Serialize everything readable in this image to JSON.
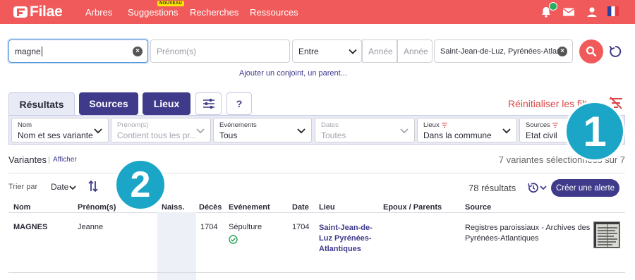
{
  "header": {
    "logo_text": "Filae",
    "nav": [
      {
        "label": "Arbres"
      },
      {
        "label": "Suggestions",
        "badge": "NOUVEAU"
      },
      {
        "label": "Recherches"
      },
      {
        "label": "Ressources"
      }
    ],
    "icons": [
      "bell-icon",
      "mail-icon",
      "user-icon",
      "flag-fr-icon"
    ]
  },
  "search": {
    "name_value": "magne",
    "firstname_placeholder": "Prénom(s)",
    "range_value": "Entre",
    "year_from_placeholder": "Année",
    "year_to_placeholder": "Année",
    "place_value": "Saint-Jean-de-Luz, Pyrénées-Atlant",
    "add_link": "Ajouter un conjoint, un parent..."
  },
  "tabs": {
    "results": "Résultats",
    "sources": "Sources",
    "places": "Lieux",
    "help": "?"
  },
  "reset_filters": "Réinitialiser les filtres",
  "filters": [
    {
      "label": "Nom",
      "value": "Nom et ses variante..."
    },
    {
      "label": "Prénom(s)",
      "value": "Contient tous les pr..."
    },
    {
      "label": "Evénements",
      "value": "Tous"
    },
    {
      "label": "Dates",
      "value": "Toutes"
    },
    {
      "label": "Lieux",
      "value": "Dans la commune"
    },
    {
      "label": "Sources",
      "value": "Etat civil"
    }
  ],
  "variants": {
    "title": "Variantes",
    "show_link": "Afficher",
    "selected": "7 variantes sélectionnées sur 7"
  },
  "sort": {
    "label": "Trier par",
    "value": "Date",
    "results_count": "78 résultats",
    "alert_button": "Créer une alerte"
  },
  "table": {
    "headers": [
      "Nom",
      "Prénom(s)",
      "Naiss.",
      "Décès",
      "Evénement",
      "Date",
      "Lieu",
      "Epoux / Parents",
      "Source"
    ],
    "rows": [
      {
        "nom": "MAGNES",
        "prenom": "Jeanne",
        "naiss": "",
        "deces": "1704",
        "evenement": "Sépulture",
        "date": "1704",
        "lieu": "Saint-Jean-de-Luz Pyrénées-Atlantiques",
        "epoux": "",
        "source": "Registres paroissiaux - Archives des Pyrénées-Atlantiques"
      }
    ]
  },
  "steps": [
    "1",
    "2"
  ],
  "colors": {
    "brand_red": "#f05a5a",
    "brand_indigo": "#3f3b8a",
    "step_cyan": "#1ba6c7"
  }
}
